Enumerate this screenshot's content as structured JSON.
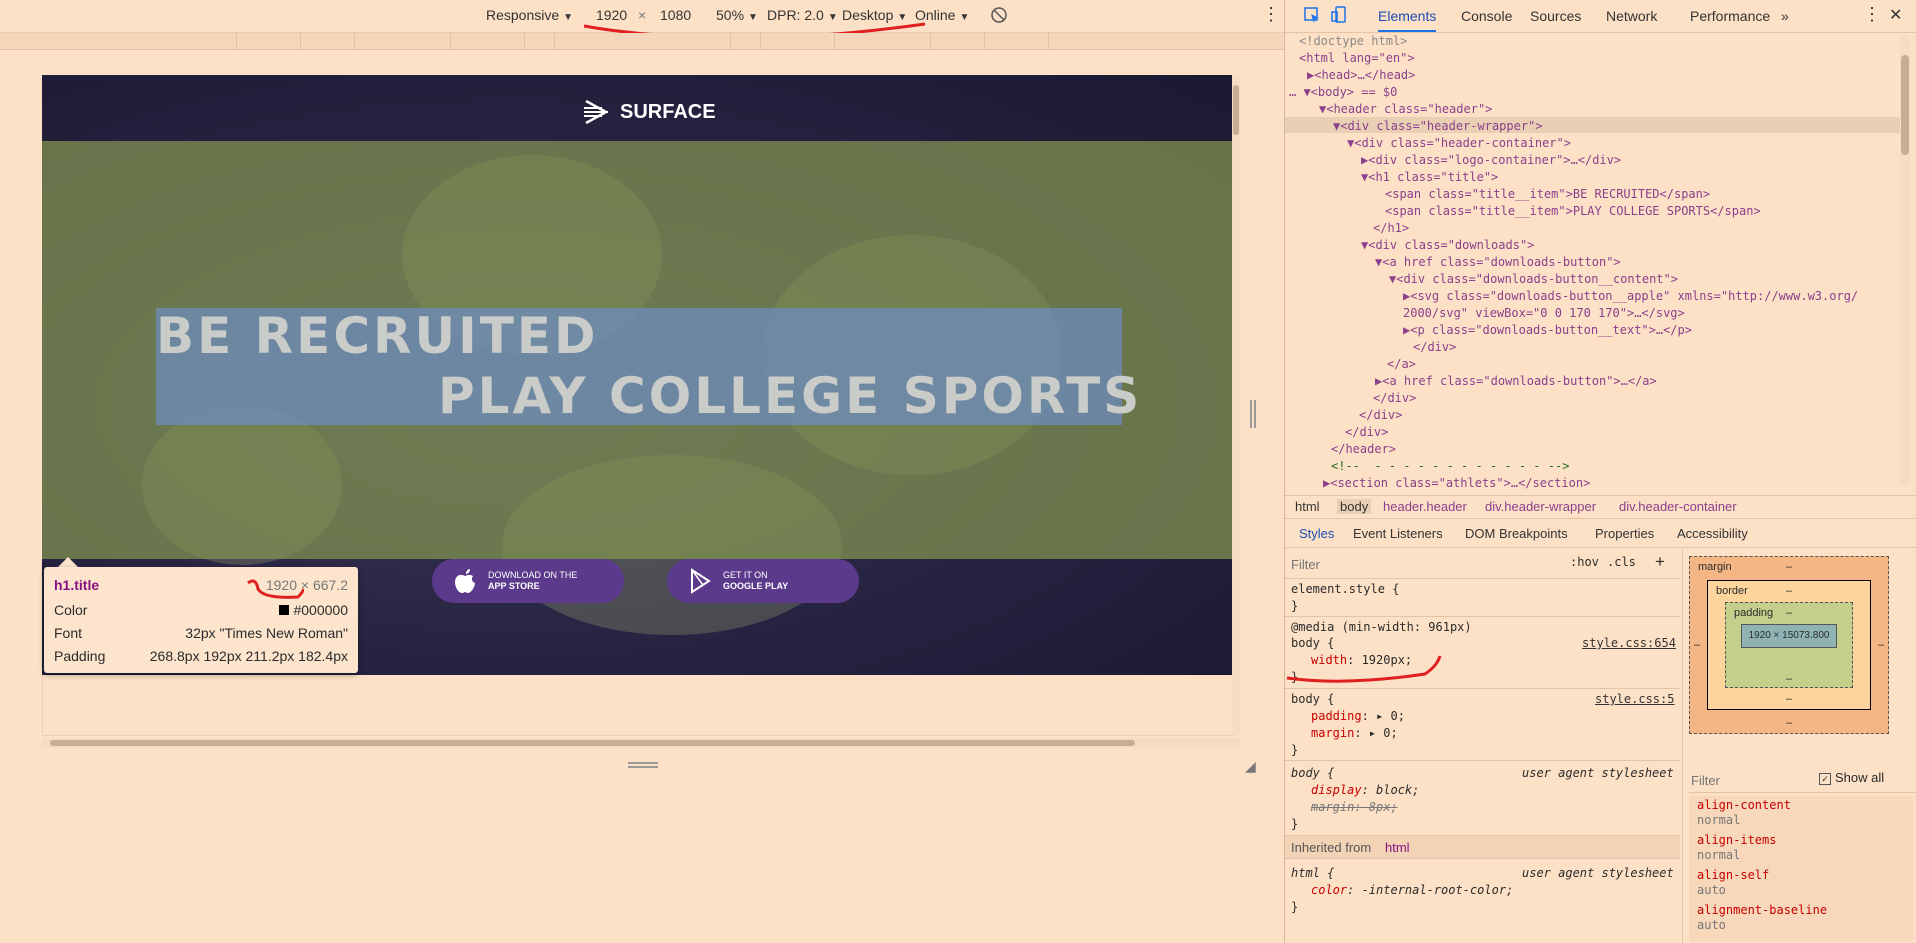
{
  "toolbar": {
    "device": "Responsive",
    "width": "1920",
    "times": "×",
    "height": "1080",
    "zoom": "50%",
    "dpr": "DPR: 2.0",
    "mode": "Desktop",
    "network": "Online"
  },
  "page": {
    "logo_text": "SURFACE",
    "title_1": "BE RECRUITED",
    "title_2": "PLAY COLLEGE SPORTS",
    "btn_apple_top": "DOWNLOAD ON THE",
    "btn_apple_bottom": "APP STORE",
    "btn_google_top": "GET IT ON",
    "btn_google_bottom": "GOOGLE PLAY"
  },
  "tooltip": {
    "element": "h1.title",
    "size": "1920 × 667.2",
    "color_label": "Color",
    "color_value": "#000000",
    "font_label": "Font",
    "font_value": "32px \"Times New Roman\"",
    "padding_label": "Padding",
    "padding_value": "268.8px 192px 211.2px 182.4px"
  },
  "devtools": {
    "tabs": [
      "Elements",
      "Console",
      "Sources",
      "Network",
      "Performance",
      "»"
    ],
    "dom_lines": [
      "<!doctype html>",
      "<html lang=\"en\">",
      "▶<head>…</head>",
      "… ▼<body> == $0",
      "▼<header class=\"header\">",
      "▼<div class=\"header-wrapper\">",
      "▼<div class=\"header-container\">",
      "▶<div class=\"logo-container\">…</div>",
      "▼<h1 class=\"title\">",
      "<span class=\"title__item\">BE RECRUITED</span>",
      "<span class=\"title__item\">PLAY COLLEGE SPORTS</span>",
      "</h1>",
      "▼<div class=\"downloads\">",
      "▼<a href class=\"downloads-button\">",
      "▼<div class=\"downloads-button__content\">",
      "▶<svg class=\"downloads-button__apple\" xmlns=\"http://www.w3.org/",
      "2000/svg\" viewBox=\"0 0 170 170\">…</svg>",
      "▶<p class=\"downloads-button__text\">…</p>",
      "</div>",
      "</a>",
      "▶<a href class=\"downloads-button\">…</a>",
      "</div>",
      "</div>",
      "</div>",
      "</header>",
      "<!--  - - - - - - - - - - - - -->",
      "▶<section class=\"athlets\">…</section>"
    ],
    "crumbs": [
      "html",
      "body",
      "header.header",
      "div.header-wrapper",
      "div.header-container"
    ],
    "subtabs": [
      "Styles",
      "Event Listeners",
      "DOM Breakpoints",
      "Properties",
      "Accessibility"
    ],
    "filter_placeholder": "Filter",
    "hov": ":hov",
    "cls": ".cls",
    "plus": "+",
    "rules": {
      "element_style": "element.style {",
      "close": "}",
      "media": "@media (min-width: 961px)",
      "body_open": "body {",
      "width_prop": "width",
      "width_val": "1920px;",
      "source_654": "style.css:654",
      "source_5": "style.css:5",
      "padding_prop": "padding",
      "padding_val": "0;",
      "margin_prop": "margin",
      "margin_val": "0;",
      "ua": "user agent stylesheet",
      "display_prop": "display",
      "display_val": "block;",
      "margin_ua": "margin: 8px;",
      "inherited": "Inherited from",
      "inherited_el": "html",
      "html_open": "html {",
      "color_prop": "color",
      "color_val": "-internal-root-color;"
    },
    "boxmodel": {
      "margin": "margin",
      "border": "border",
      "padding": "padding",
      "dash": "–",
      "content": "1920 × 15073.800"
    },
    "computed": {
      "filter": "Filter",
      "show_all": "Show all",
      "props": [
        {
          "name": "align-content",
          "value": "normal"
        },
        {
          "name": "align-items",
          "value": "normal"
        },
        {
          "name": "align-self",
          "value": "auto"
        },
        {
          "name": "alignment-baseline",
          "value": "auto"
        }
      ]
    }
  }
}
